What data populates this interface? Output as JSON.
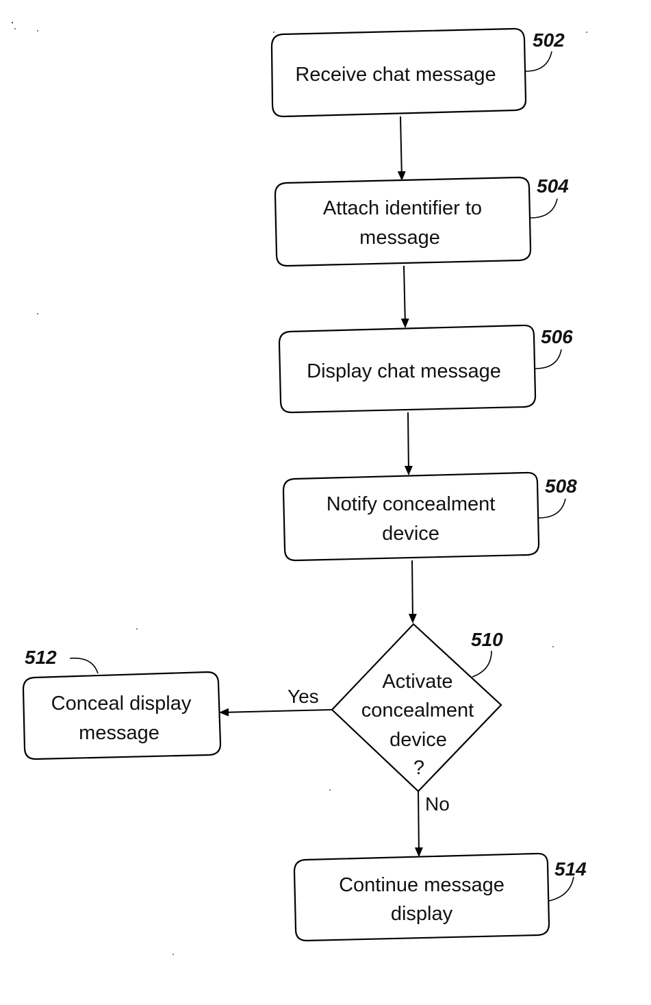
{
  "diagram": {
    "type": "flowchart",
    "nodes": [
      {
        "id": "502",
        "shape": "process",
        "lines": [
          "Receive chat message"
        ]
      },
      {
        "id": "504",
        "shape": "process",
        "lines": [
          "Attach identifier to",
          "message"
        ]
      },
      {
        "id": "506",
        "shape": "process",
        "lines": [
          "Display chat message"
        ]
      },
      {
        "id": "508",
        "shape": "process",
        "lines": [
          "Notify concealment",
          "device"
        ]
      },
      {
        "id": "510",
        "shape": "decision",
        "lines": [
          "Activate",
          "concealment",
          "device",
          "?"
        ]
      },
      {
        "id": "512",
        "shape": "process",
        "lines": [
          "Conceal display",
          "message"
        ]
      },
      {
        "id": "514",
        "shape": "process",
        "lines": [
          "Continue message",
          "display"
        ]
      }
    ],
    "edges": [
      {
        "from": "502",
        "to": "504",
        "label": ""
      },
      {
        "from": "504",
        "to": "506",
        "label": ""
      },
      {
        "from": "506",
        "to": "508",
        "label": ""
      },
      {
        "from": "508",
        "to": "510",
        "label": ""
      },
      {
        "from": "510",
        "to": "512",
        "label": "Yes"
      },
      {
        "from": "510",
        "to": "514",
        "label": "No"
      }
    ],
    "refs": {
      "r502": "502",
      "r504": "504",
      "r506": "506",
      "r508": "508",
      "r510": "510",
      "r512": "512",
      "r514": "514"
    },
    "edge_labels": {
      "yes": "Yes",
      "no": "No"
    }
  }
}
